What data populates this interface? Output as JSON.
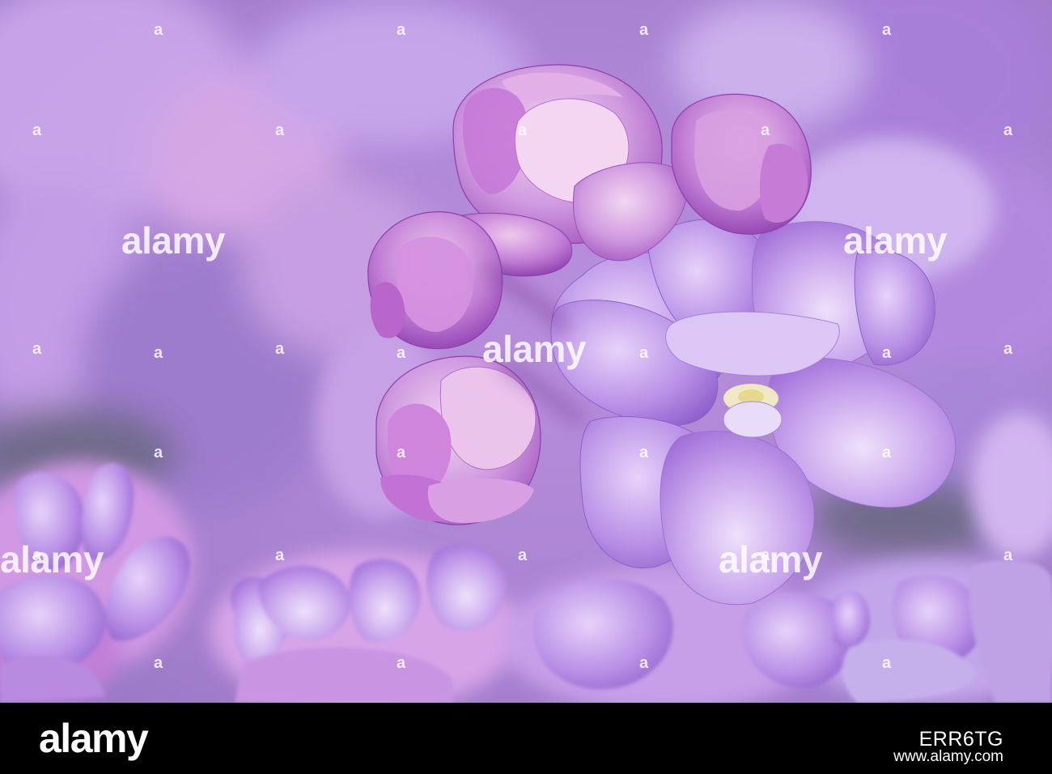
{
  "photo": {
    "subject": "lilac-flowers",
    "colors": {
      "background": "#b892d6",
      "petal_light": "#d8bff0",
      "petal_mid": "#b58ae0",
      "petal_deep": "#8a55c4",
      "bud_pink": "#c68ad8",
      "bud_deep": "#9a4fb8",
      "center_yellow": "#e6d98c"
    }
  },
  "watermark": {
    "text": "a",
    "big_text": "alamy"
  },
  "footer": {
    "brand": "alamy",
    "image_code": "ERR6TG",
    "url": "www.alamy.com"
  }
}
